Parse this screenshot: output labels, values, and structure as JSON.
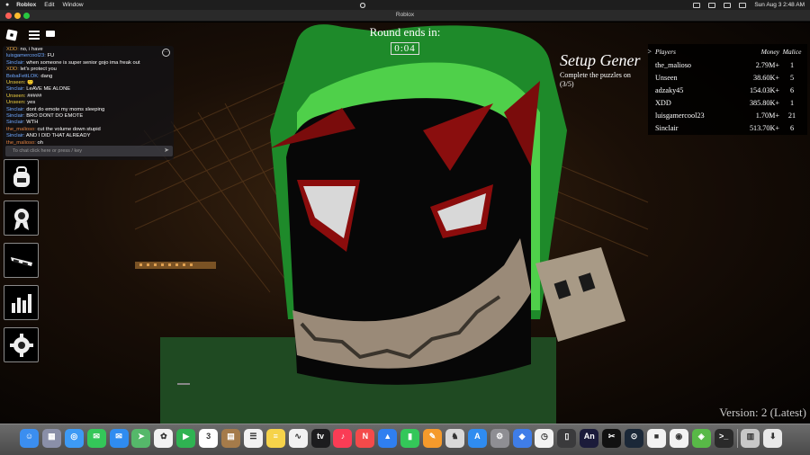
{
  "menubar": {
    "app": "Roblox",
    "items": [
      "Edit",
      "Window"
    ],
    "clock": "Sun Aug 3  2:48 AM"
  },
  "window": {
    "title": "Roblox"
  },
  "round": {
    "label": "Round ends in:",
    "time": "0:04"
  },
  "objective": {
    "title": "Setup Gener",
    "subtitle": "Complete the puzzles on",
    "progress": "(3/5)"
  },
  "chat": {
    "messages": [
      {
        "user": "XDD:",
        "text": "no, i have",
        "color": "#e0a040"
      },
      {
        "user": "luisgamercool23:",
        "text": "FU",
        "color": "#6fa8ff"
      },
      {
        "user": "Sinclair:",
        "text": "when someone is super senior gojo ima freak out",
        "color": "#6fa8ff"
      },
      {
        "user": "XDD:",
        "text": "let's protect you",
        "color": "#e0a040"
      },
      {
        "user": "BobaFettLOK:",
        "text": "dang",
        "color": "#6fa8ff"
      },
      {
        "user": "Unseen:",
        "text": "🙂",
        "color": "#f0d040"
      },
      {
        "user": "Sinclair:",
        "text": "LeAVE ME ALONE",
        "color": "#6fa8ff"
      },
      {
        "user": "Unseen:",
        "text": "#####",
        "color": "#f0d040"
      },
      {
        "user": "Unseen:",
        "text": "yes",
        "color": "#f0d040"
      },
      {
        "user": "Sinclair:",
        "text": "dont do emote my moms sleeping",
        "color": "#6fa8ff"
      },
      {
        "user": "Sinclair:",
        "text": "BRO DONT DO EMOTE",
        "color": "#6fa8ff"
      },
      {
        "user": "Sinclair:",
        "text": "WTH",
        "color": "#6fa8ff"
      },
      {
        "user": "the_malioso:",
        "text": "cut the volume down stupid",
        "color": "#e08040"
      },
      {
        "user": "Sinclair:",
        "text": "AND I DID THAT ALREADY",
        "color": "#6fa8ff"
      },
      {
        "user": "the_malioso:",
        "text": "oh",
        "color": "#e08040"
      }
    ],
    "placeholder": "To chat click here or press / key",
    "send_icon": "send-arrow-icon"
  },
  "leaderboard": {
    "headers": [
      "Players",
      "Money",
      "Malice"
    ],
    "rows": [
      {
        "name": "the_malioso",
        "money": "2.79M+",
        "malice": "1"
      },
      {
        "name": "Unseen",
        "money": "38.60K+",
        "malice": "5"
      },
      {
        "name": "adzaky45",
        "money": "154.03K+",
        "malice": "6"
      },
      {
        "name": "XDD",
        "money": "385.80K+",
        "malice": "1"
      },
      {
        "name": "luisgamercool23",
        "money": "1.70M+",
        "malice": "21"
      },
      {
        "name": "Sinclair",
        "money": "513.70K+",
        "malice": "6"
      }
    ]
  },
  "side_buttons": [
    "backpack-icon",
    "badge-ribbon-icon",
    "glasses-icon",
    "bar-chart-icon",
    "gear-icon"
  ],
  "version": "Version: 2 (Latest)",
  "dock": [
    {
      "name": "finder",
      "color": "#3b8ef0",
      "glyph": "☺"
    },
    {
      "name": "launchpad",
      "color": "#8a8fa8",
      "glyph": "▦"
    },
    {
      "name": "safari",
      "color": "#3d9af5",
      "glyph": "◎"
    },
    {
      "name": "messages",
      "color": "#34c759",
      "glyph": "✉"
    },
    {
      "name": "mail",
      "color": "#2f8cf0",
      "glyph": "✉"
    },
    {
      "name": "maps",
      "color": "#55b86a",
      "glyph": "➤"
    },
    {
      "name": "photos",
      "color": "#f2f2f2",
      "glyph": "✿"
    },
    {
      "name": "facetime",
      "color": "#2fb352",
      "glyph": "▶"
    },
    {
      "name": "calendar",
      "color": "#ffffff",
      "glyph": "3"
    },
    {
      "name": "archive",
      "color": "#a57b4a",
      "glyph": "▤"
    },
    {
      "name": "reminders",
      "color": "#f2f2f2",
      "glyph": "☰"
    },
    {
      "name": "notes",
      "color": "#f6d34a",
      "glyph": "≡"
    },
    {
      "name": "freeform",
      "color": "#f2f2f2",
      "glyph": "∿"
    },
    {
      "name": "tv",
      "color": "#1c1c1e",
      "glyph": "tv"
    },
    {
      "name": "music",
      "color": "#fa3c55",
      "glyph": "♪"
    },
    {
      "name": "news",
      "color": "#f44a4a",
      "glyph": "N"
    },
    {
      "name": "keynote",
      "color": "#2f7ff0",
      "glyph": "▲"
    },
    {
      "name": "numbers",
      "color": "#34c759",
      "glyph": "▮"
    },
    {
      "name": "pages",
      "color": "#f59a2b",
      "glyph": "✎"
    },
    {
      "name": "chess",
      "color": "#d8d8d8",
      "glyph": "♞"
    },
    {
      "name": "app-store",
      "color": "#2f8cf0",
      "glyph": "A"
    },
    {
      "name": "system-settings",
      "color": "#8e8e93",
      "glyph": "⚙"
    },
    {
      "name": "roblox-studio",
      "color": "#3f7de8",
      "glyph": "◆"
    },
    {
      "name": "clock",
      "color": "#f2f2f2",
      "glyph": "◷"
    },
    {
      "name": "iphone-mirroring",
      "color": "#3a3a3c",
      "glyph": "▯"
    },
    {
      "name": "animate",
      "color": "#1b1b3a",
      "glyph": "An"
    },
    {
      "name": "capcut",
      "color": "#111111",
      "glyph": "✂"
    },
    {
      "name": "steam",
      "color": "#1b2838",
      "glyph": "⊙"
    },
    {
      "name": "roblox",
      "color": "#f2f2f2",
      "glyph": "■"
    },
    {
      "name": "chrome",
      "color": "#f2f2f2",
      "glyph": "◉"
    },
    {
      "name": "bluestacks",
      "color": "#58b947",
      "glyph": "◈"
    },
    {
      "name": "terminal",
      "color": "#2a2a2a",
      "glyph": ">_"
    },
    {
      "name": "trash",
      "color": "#c8c8c8",
      "glyph": "▥"
    },
    {
      "name": "downloads",
      "color": "#e8e8e8",
      "glyph": "⬇"
    }
  ]
}
